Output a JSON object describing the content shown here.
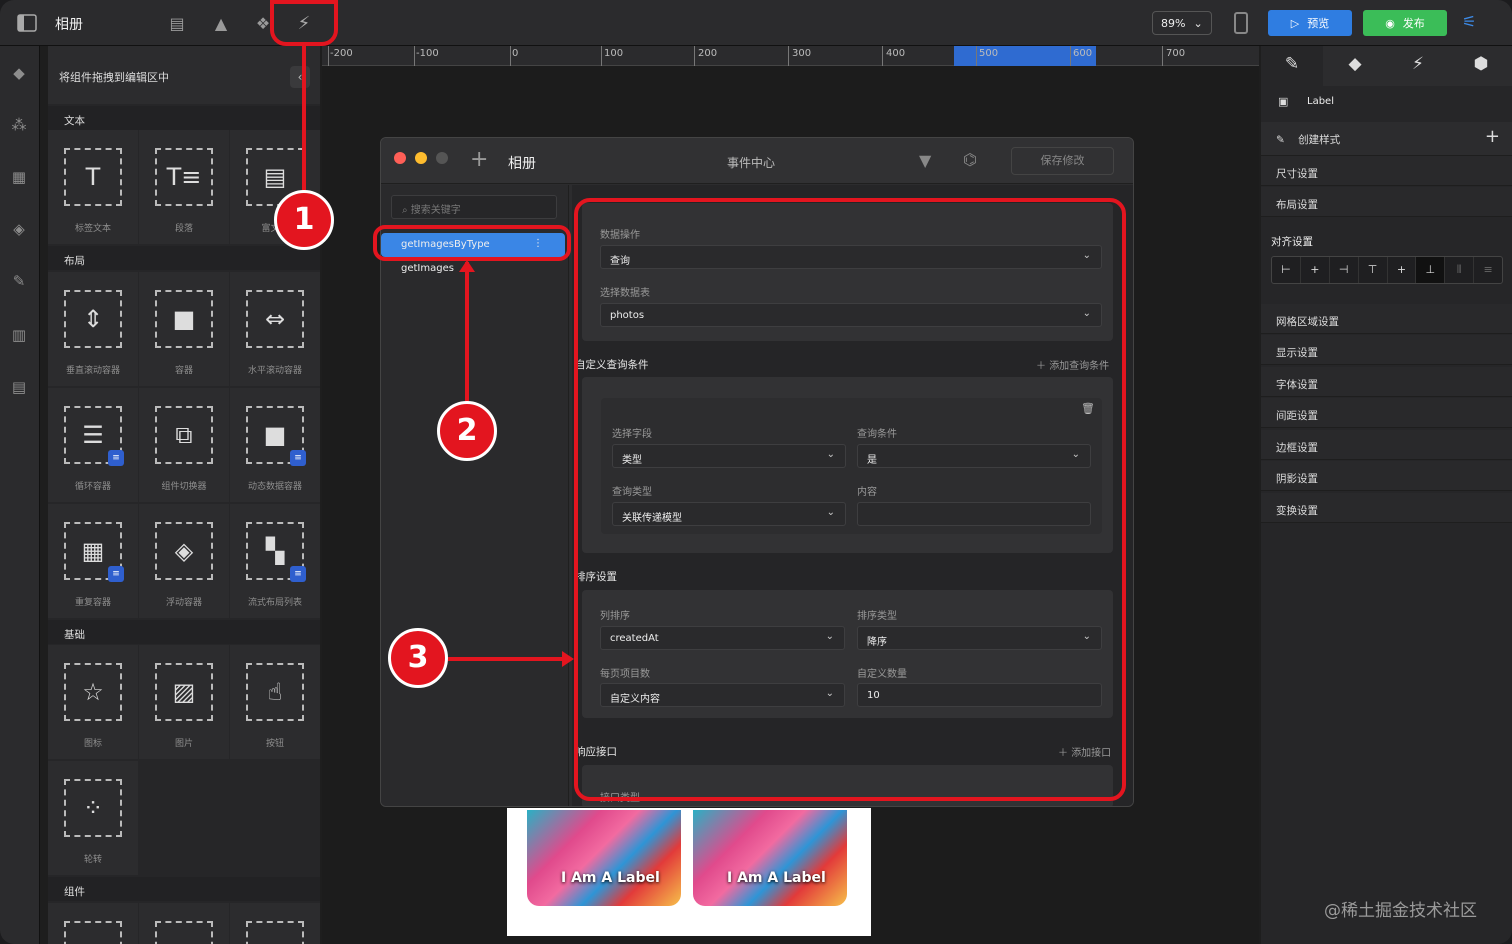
{
  "app": {
    "title": "相册"
  },
  "toolbar": {
    "icons": [
      "sidebar-toggle-icon",
      "page-icon",
      "triangle-icon",
      "components-icon",
      "events-icon"
    ],
    "zoom": "89%",
    "preview_label": "预览",
    "publish_label": "发布",
    "accent": "#2f7de1",
    "publish_color": "#3bbd58"
  },
  "rail": {
    "icons": [
      "cube-icon",
      "blocks-icon",
      "grid-icon",
      "layers-icon",
      "pin-icon",
      "layout-icon",
      "table-icon"
    ]
  },
  "component_panel": {
    "hint": "将组件拖拽到编辑区中",
    "collapse_icon": "chevron-left-icon",
    "sections": {
      "text": {
        "title": "文本",
        "items": [
          {
            "label": "标签文本",
            "icon": "T"
          },
          {
            "label": "段落",
            "icon": "T≡"
          },
          {
            "label": "富文本",
            "icon": "▤"
          }
        ]
      },
      "layout": {
        "title": "布局",
        "items": [
          {
            "label": "垂直滚动容器",
            "icon": "⇕"
          },
          {
            "label": "容器",
            "icon": "■"
          },
          {
            "label": "水平滚动容器",
            "icon": "⇔"
          },
          {
            "label": "循环容器",
            "icon": "☰"
          },
          {
            "label": "组件切换器",
            "icon": "⧉"
          },
          {
            "label": "动态数据容器",
            "icon": "■"
          },
          {
            "label": "重复容器",
            "icon": "▦"
          },
          {
            "label": "浮动容器",
            "icon": "◈"
          },
          {
            "label": "流式布局列表",
            "icon": "▚"
          }
        ]
      },
      "basic": {
        "title": "基础",
        "items": [
          {
            "label": "图标",
            "icon": "☆"
          },
          {
            "label": "图片",
            "icon": "▨"
          },
          {
            "label": "按钮",
            "icon": "☝"
          },
          {
            "label": "轮转",
            "icon": "⁘"
          }
        ]
      },
      "components": {
        "title": "组件"
      }
    }
  },
  "ruler": {
    "ticks": [
      "-200",
      "-100",
      "0",
      "100",
      "200",
      "300",
      "400",
      "500",
      "600",
      "700"
    ]
  },
  "dialog": {
    "title": "相册",
    "center_title": "事件中心",
    "save_label": "保存修改",
    "search_placeholder": "搜索关键字",
    "apis": [
      "getImagesByType",
      "getImages"
    ],
    "data_op": {
      "label": "数据操作",
      "value": "查询",
      "table_label": "选择数据表",
      "table_value": "photos"
    },
    "custom_query": {
      "title": "自定义查询条件",
      "add_label": "添加查询条件",
      "field_label": "选择字段",
      "field_value": "类型",
      "cond_label": "查询条件",
      "cond_value": "是",
      "type_label": "查询类型",
      "type_value": "关联传递模型",
      "content_label": "内容",
      "content_value": ""
    },
    "sort": {
      "title": "排序设置",
      "col_label": "列排序",
      "col_value": "createdAt",
      "order_label": "排序类型",
      "order_value": "降序",
      "page_label": "每页项目数",
      "page_value": "自定义内容",
      "count_label": "自定义数量",
      "count_value": "10"
    },
    "response": {
      "title": "响应接口",
      "add_label": "添加接口",
      "partial": "接口类型"
    }
  },
  "preview_cards": [
    {
      "label": "I Am A Label"
    },
    {
      "label": "I Am A Label"
    }
  ],
  "right_panel": {
    "tabs": [
      "brush-icon",
      "diamond-icon",
      "bolt-icon",
      "box-icon"
    ],
    "component_name": "Label",
    "create_style": "创建样式",
    "rows": [
      "尺寸设置",
      "布局设置"
    ],
    "align_title": "对齐设置",
    "align_buttons": [
      "⊢",
      "+",
      "⊣",
      "⊤",
      "+",
      "⊥",
      "⦀",
      "≡"
    ],
    "rows2": [
      "网格区域设置",
      "显示设置",
      "字体设置",
      "间距设置",
      "边框设置",
      "阴影设置",
      "变换设置"
    ]
  },
  "annotations": {
    "badge1": "1",
    "badge2": "2",
    "badge3": "3",
    "color": "#e3151f"
  },
  "watermark": "@稀土掘金技术社区"
}
